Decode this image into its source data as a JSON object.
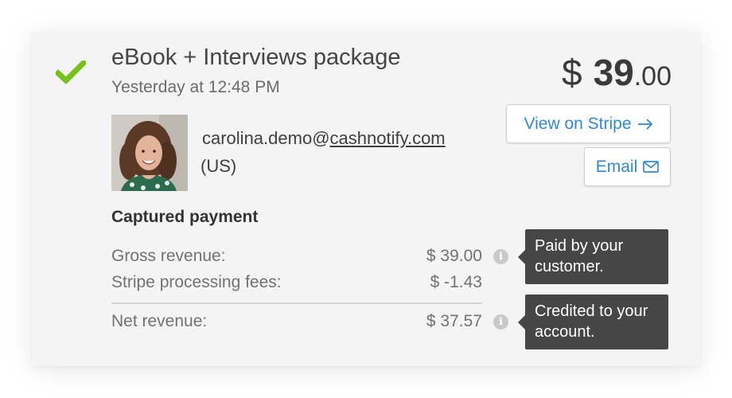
{
  "payment": {
    "product_title": "eBook + Interviews package",
    "timestamp": "Yesterday at 12:48 PM",
    "amount": {
      "currency": "$",
      "major": "39",
      "cents": ".00"
    },
    "status_icon": "checkmark-icon",
    "status_color": "#75c21b"
  },
  "actions": {
    "view_on_stripe": "View on Stripe",
    "view_on_stripe_icon": "arrow-right-icon",
    "email": "Email",
    "email_icon": "envelope-icon"
  },
  "customer": {
    "email_user": "carolina.demo@",
    "email_domain": "cashnotify.com",
    "country": "(US)",
    "avatar_icon": "customer-photo"
  },
  "captured": {
    "title": "Captured payment",
    "rows": [
      {
        "label": "Gross revenue:",
        "value": "$ 39.00"
      },
      {
        "label": "Stripe processing fees:",
        "value": "$ -1.43"
      },
      {
        "label": "Net revenue:",
        "value": "$ 37.57"
      }
    ],
    "tooltips": [
      "Paid by your customer.",
      "Credited to your account."
    ]
  },
  "colors": {
    "link": "#2f87de",
    "tooltip_bg": "#464646",
    "card_bg": "#f4f4f4"
  }
}
